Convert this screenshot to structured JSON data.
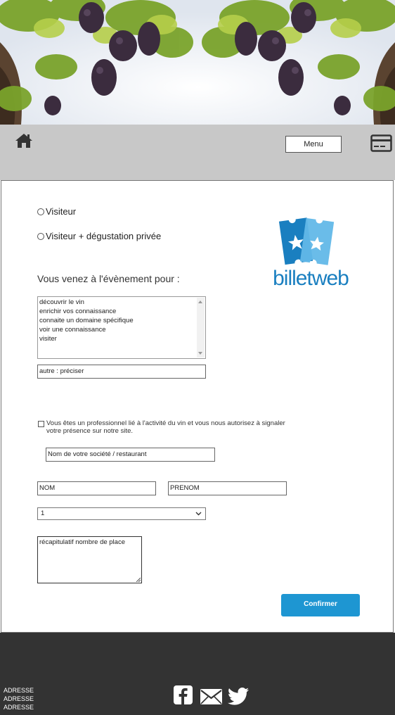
{
  "header": {
    "menu_label": "Menu",
    "icons": [
      "home-icon",
      "credit-card-icon"
    ]
  },
  "form": {
    "radio_options": [
      "Visiteur",
      "Visiteur + dégustation privée"
    ],
    "logo_text": "billetweb",
    "question": "Vous venez à l'évènement pour :",
    "reasons": [
      "découvrir le vin",
      "enrichir vos connaissance",
      "connaite un domaine spécifique",
      "voir une connaissance",
      "visiter"
    ],
    "other_value": "autre : préciser",
    "professional_text": "Vous êtes un professionnel lié à l'activité du vin et vous nous autorisez à signaler votre présence sur notre site.",
    "company_value": "Nom de votre société / restaurant",
    "last_name_value": "NOM",
    "first_name_value": "PRENOM",
    "quantity_value": "1",
    "summary_value": "récapitulatif nombre de place",
    "confirm_label": "Confirmer"
  },
  "footer": {
    "address_lines": [
      "ADRESSE",
      "ADRESSE",
      "ADRESSE"
    ],
    "social_icons": [
      "facebook-icon",
      "email-icon",
      "twitter-icon"
    ]
  },
  "colors": {
    "nav_bg": "#c8c8c8",
    "footer_bg": "#333333",
    "accent": "#1e96d2",
    "logo_dark": "#1a7fc0",
    "logo_light": "#62b8e8"
  }
}
